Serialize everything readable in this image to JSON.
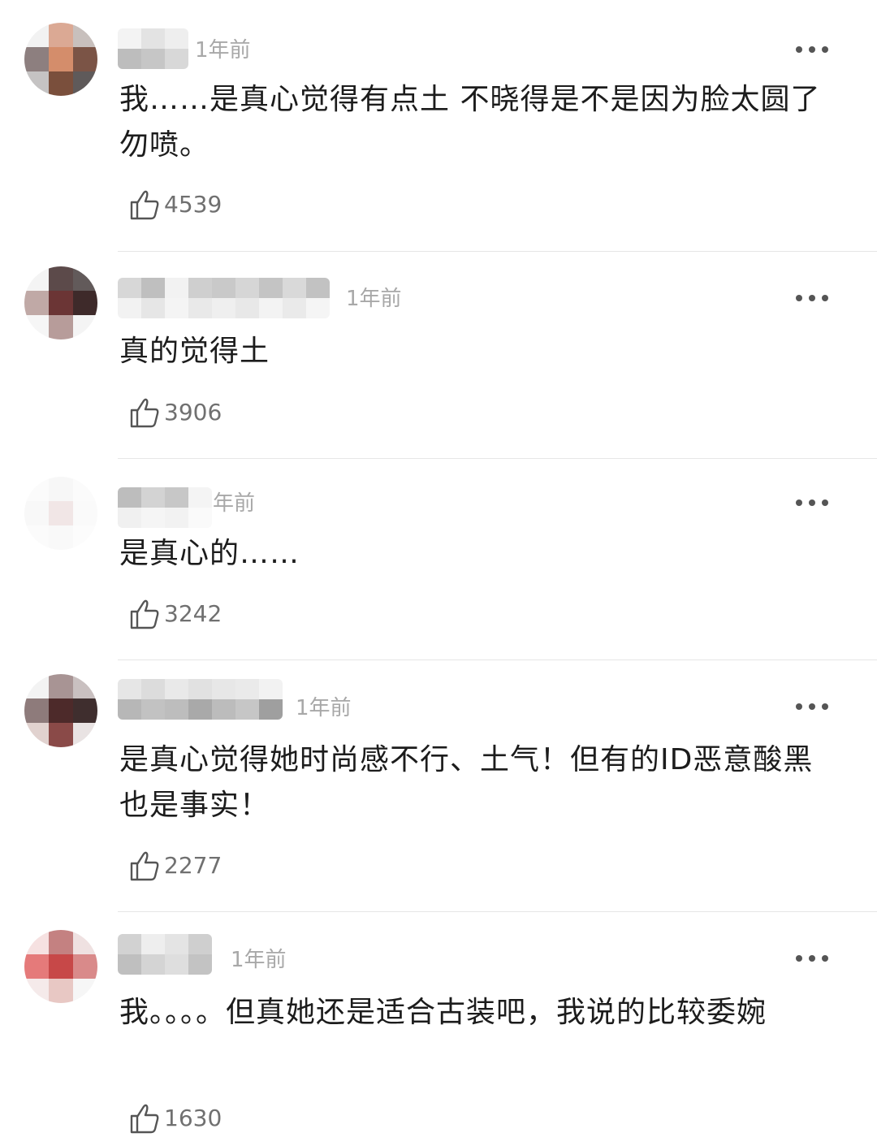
{
  "comments": [
    {
      "time": "1年前",
      "text": "我……是真心觉得有点土 不晓得是不是因为脸太圆了 勿喷。",
      "likes": "4539"
    },
    {
      "time": "1年前",
      "text": "真的觉得土",
      "likes": "3906"
    },
    {
      "time": "年前",
      "text": "是真心的……",
      "likes": "3242"
    },
    {
      "time": "1年前",
      "text": "是真心觉得她时尚感不行、土气！但有的ID恶意酸黑也是事实！",
      "likes": "2277"
    },
    {
      "time": "1年前",
      "text": "我。。。。但真她还是适合古装吧，我说的比较委婉",
      "likes": "1630"
    }
  ],
  "icons": {
    "like": "thumbs-up-icon",
    "more": "more-dots-icon",
    "avatar": "pixelated-avatar"
  },
  "colors": {
    "text": "#1c1c1c",
    "meta": "#a8a8a8",
    "divider": "#e6e6e6"
  }
}
